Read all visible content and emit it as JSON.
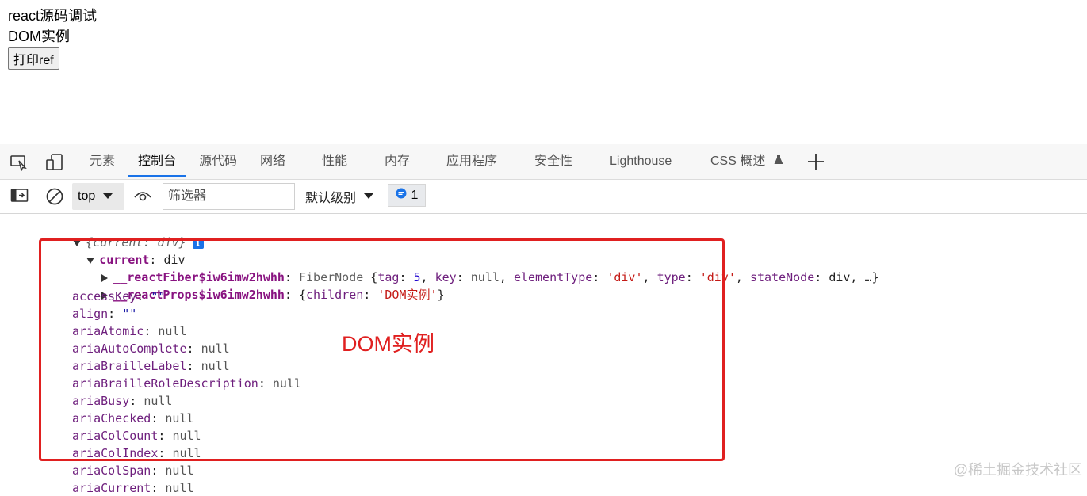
{
  "page": {
    "lines": [
      "react源码调试",
      "DOM实例"
    ],
    "button_label": "打印ref"
  },
  "devtools": {
    "tabs": [
      {
        "label": "元素"
      },
      {
        "label": "控制台",
        "active": true
      },
      {
        "label": "源代码"
      },
      {
        "label": "网络"
      },
      {
        "label": "性能"
      },
      {
        "label": "内存"
      },
      {
        "label": "应用程序"
      },
      {
        "label": "安全性"
      },
      {
        "label": "Lighthouse"
      },
      {
        "label": "CSS 概述"
      }
    ],
    "toolbar": {
      "context": "top",
      "filter_placeholder": "筛选器",
      "level": "默认级别",
      "message_count": "1"
    },
    "console": {
      "root_label": "{current: div}",
      "current_key": "current",
      "current_value": "div",
      "fiber": {
        "key": "__reactFiber$iw6imw2hwhh",
        "summary_type": "FiberNode",
        "props": [
          {
            "k": "tag",
            "v": "5",
            "t": "num"
          },
          {
            "k": "key",
            "v": "null",
            "t": "nul"
          },
          {
            "k": "elementType",
            "v": "'div'",
            "t": "strv"
          },
          {
            "k": "type",
            "v": "'div'",
            "t": "strv"
          },
          {
            "k": "stateNode",
            "v": "div",
            "t": "tw"
          }
        ]
      },
      "props_entry": {
        "key": "__reactProps$iw6imw2hwhh",
        "child_key": "children",
        "child_value": "'DOM实例'"
      },
      "properties": [
        {
          "key": "accessKey",
          "value": "\"\"",
          "type": "str"
        },
        {
          "key": "align",
          "value": "\"\"",
          "type": "str"
        },
        {
          "key": "ariaAtomic",
          "value": "null",
          "type": "nul"
        },
        {
          "key": "ariaAutoComplete",
          "value": "null",
          "type": "nul"
        },
        {
          "key": "ariaBrailleLabel",
          "value": "null",
          "type": "nul"
        },
        {
          "key": "ariaBrailleRoleDescription",
          "value": "null",
          "type": "nul"
        },
        {
          "key": "ariaBusy",
          "value": "null",
          "type": "nul"
        },
        {
          "key": "ariaChecked",
          "value": "null",
          "type": "nul"
        },
        {
          "key": "ariaColCount",
          "value": "null",
          "type": "nul"
        },
        {
          "key": "ariaColIndex",
          "value": "null",
          "type": "nul"
        },
        {
          "key": "ariaColSpan",
          "value": "null",
          "type": "nul"
        },
        {
          "key": "ariaCurrent",
          "value": "null",
          "type": "nul"
        }
      ]
    }
  },
  "annotation": "DOM实例",
  "watermark": "@稀土掘金技术社区",
  "colors": {
    "highlight": "#e02020",
    "accent": "#1a73e8"
  }
}
